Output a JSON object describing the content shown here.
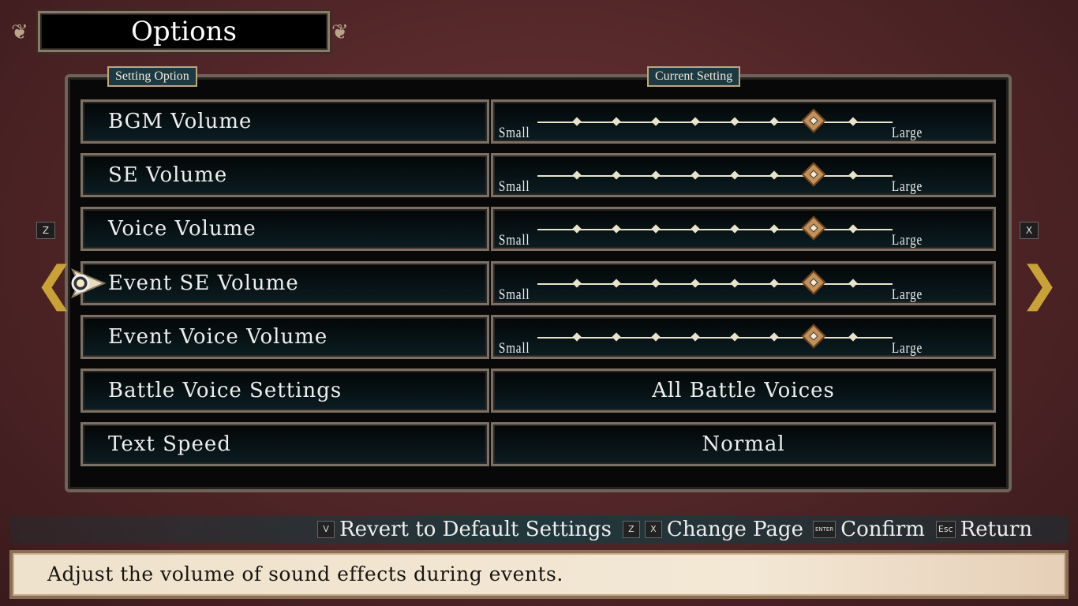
{
  "title": "Options",
  "columns": {
    "setting": "Setting Option",
    "current": "Current Setting"
  },
  "slider_labels": {
    "min": "Small",
    "max": "Large"
  },
  "rows": [
    {
      "label": "BGM Volume",
      "type": "slider",
      "level": 7,
      "max": 9
    },
    {
      "label": "SE Volume",
      "type": "slider",
      "level": 7,
      "max": 9
    },
    {
      "label": "Voice Volume",
      "type": "slider",
      "level": 7,
      "max": 9
    },
    {
      "label": "Event SE Volume",
      "type": "slider",
      "level": 7,
      "max": 9,
      "selected": true
    },
    {
      "label": "Event Voice Volume",
      "type": "slider",
      "level": 7,
      "max": 9
    },
    {
      "label": "Battle Voice Settings",
      "type": "value",
      "value": "All Battle Voices"
    },
    {
      "label": "Text Speed",
      "type": "value",
      "value": "Normal"
    }
  ],
  "page_keys": {
    "prev": "Z",
    "next": "X"
  },
  "hints": {
    "revert_key": "V",
    "revert": "Revert to Default Settings",
    "page_key1": "Z",
    "page_key2": "X",
    "page": "Change Page",
    "confirm_key": "ENTER",
    "confirm": "Confirm",
    "return_key": "Esc",
    "return": "Return"
  },
  "description": "Adjust the volume of sound effects during events.",
  "colors": {
    "background": "#4e2426",
    "accent": "#c9a235",
    "knob": "#c49055"
  }
}
